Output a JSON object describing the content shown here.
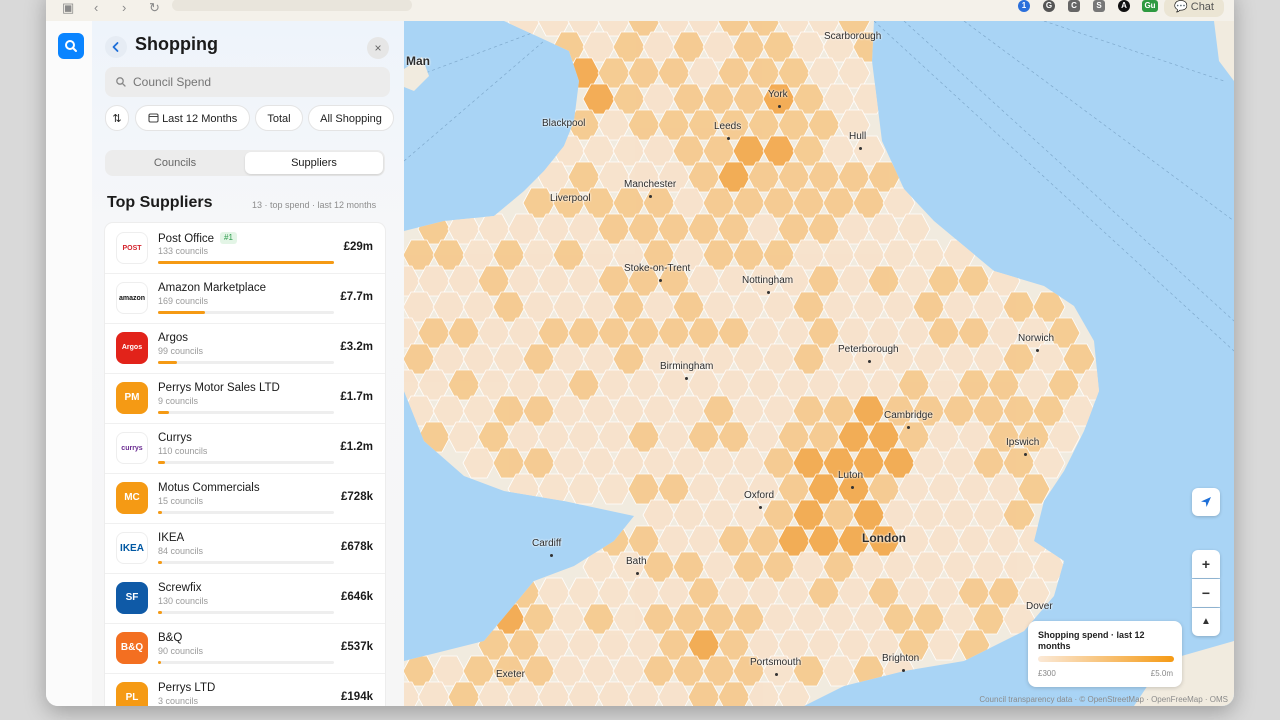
{
  "browser": {
    "chat_label": "Chat",
    "extensions": [
      "1",
      "G",
      "C",
      "S",
      "A",
      "Gu"
    ]
  },
  "panel": {
    "title": "Shopping",
    "close": "×",
    "search": {
      "placeholder": "Council Spend",
      "value": ""
    },
    "filters": {
      "period": "Last 12 Months",
      "measure": "Total",
      "category": "All Shopping"
    },
    "tabs": {
      "councils": "Councils",
      "suppliers": "Suppliers",
      "active": "Suppliers"
    },
    "section_title": "Top Suppliers",
    "section_meta": "13 · top spend · last 12 months",
    "suppliers": [
      {
        "name": "Post Office",
        "badge": "#1",
        "councils": "133 councils",
        "value": "£29m",
        "share": 1.0,
        "logo_text": "POST OFFICE",
        "logo_bg": "#fff",
        "logo_color": "#d4232c"
      },
      {
        "name": "Amazon Marketplace",
        "badge": "",
        "councils": "169 councils",
        "value": "£7.7m",
        "share": 0.265,
        "logo_text": "amazon",
        "logo_bg": "#fff",
        "logo_color": "#111"
      },
      {
        "name": "Argos",
        "badge": "",
        "councils": "99 councils",
        "value": "£3.2m",
        "share": 0.11,
        "logo_text": "Argos",
        "logo_bg": "#e2231a",
        "logo_color": "#fff"
      },
      {
        "name": "Perrys Motor Sales LTD",
        "badge": "",
        "councils": "9 councils",
        "value": "£1.7m",
        "share": 0.06,
        "logo_text": "PM",
        "logo_bg": "#f59a14",
        "logo_color": "#fff"
      },
      {
        "name": "Currys",
        "badge": "",
        "councils": "110 councils",
        "value": "£1.2m",
        "share": 0.042,
        "logo_text": "currys",
        "logo_bg": "#fff",
        "logo_color": "#6a2c91"
      },
      {
        "name": "Motus Commercials",
        "badge": "",
        "councils": "15 councils",
        "value": "£728k",
        "share": 0.025,
        "logo_text": "MC",
        "logo_bg": "#f59a14",
        "logo_color": "#fff"
      },
      {
        "name": "IKEA",
        "badge": "",
        "councils": "84 councils",
        "value": "£678k",
        "share": 0.023,
        "logo_text": "IKEA",
        "logo_bg": "#fff",
        "logo_color": "#0058a3"
      },
      {
        "name": "Screwfix",
        "badge": "",
        "councils": "130 councils",
        "value": "£646k",
        "share": 0.022,
        "logo_text": "SF",
        "logo_bg": "#0f5aa7",
        "logo_color": "#fff"
      },
      {
        "name": "B&Q",
        "badge": "",
        "councils": "90 councils",
        "value": "£537k",
        "share": 0.019,
        "logo_text": "B&Q",
        "logo_bg": "#f36f21",
        "logo_color": "#fff"
      },
      {
        "name": "Perrys LTD",
        "badge": "",
        "councils": "3 councils",
        "value": "£194k",
        "share": 0.007,
        "logo_text": "PL",
        "logo_bg": "#f59a14",
        "logo_color": "#fff"
      }
    ]
  },
  "map": {
    "places": [
      "Man",
      "Scarborough",
      "York",
      "Blackpool",
      "Leeds",
      "Hull",
      "Manchester",
      "Liverpool",
      "Stoke-on-Trent",
      "Nottingham",
      "Peterborough",
      "Norwich",
      "Birmingham",
      "Cambridge",
      "Ipswich",
      "Luton",
      "Oxford",
      "London",
      "Cardiff",
      "Bath",
      "Dover",
      "Exeter",
      "Portsmouth",
      "Brighton"
    ],
    "legend": {
      "title": "Shopping spend · last 12 months",
      "min": "£300",
      "max": "£5.0m"
    },
    "attribution": "Council transparency data · © OpenStreetMap · OpenFreeMap · OMS",
    "zoom_in": "+",
    "zoom_out": "−",
    "compass": "▲",
    "colors": {
      "sea": "#a9d4f5",
      "land": "#f1ebdf",
      "low": "#f8e2cb",
      "mid": "#f6c98d",
      "high": "#f3a84b"
    }
  }
}
